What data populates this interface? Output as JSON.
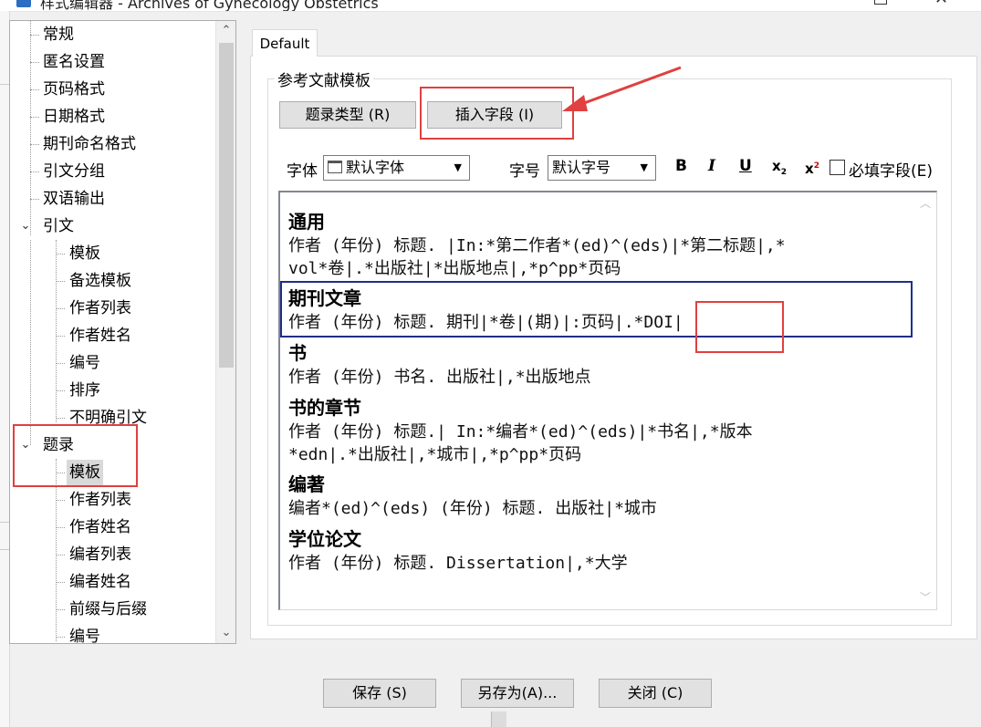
{
  "window": {
    "title": "样式编辑器 - Archives of Gynecology Obstetrics"
  },
  "tree": {
    "items": [
      {
        "label": "常规",
        "level": 1
      },
      {
        "label": "匿名设置",
        "level": 1
      },
      {
        "label": "页码格式",
        "level": 1
      },
      {
        "label": "日期格式",
        "level": 1
      },
      {
        "label": "期刊命名格式",
        "level": 1
      },
      {
        "label": "引文分组",
        "level": 1
      },
      {
        "label": "双语输出",
        "level": 1
      },
      {
        "label": "引文",
        "level": 1,
        "expanded": true
      },
      {
        "label": "模板",
        "level": 2
      },
      {
        "label": "备选模板",
        "level": 2
      },
      {
        "label": "作者列表",
        "level": 2
      },
      {
        "label": "作者姓名",
        "level": 2
      },
      {
        "label": "编号",
        "level": 2
      },
      {
        "label": "排序",
        "level": 2
      },
      {
        "label": "不明确引文",
        "level": 2
      },
      {
        "label": "题录",
        "level": 1,
        "expanded": true
      },
      {
        "label": "模板",
        "level": 2,
        "selected": true
      },
      {
        "label": "作者列表",
        "level": 2
      },
      {
        "label": "作者姓名",
        "level": 2
      },
      {
        "label": "编者列表",
        "level": 2
      },
      {
        "label": "编者姓名",
        "level": 2
      },
      {
        "label": "前缀与后缀",
        "level": 2
      },
      {
        "label": "编号",
        "level": 2
      }
    ]
  },
  "tab": {
    "label": "Default"
  },
  "group": {
    "title": "参考文献模板"
  },
  "toolbar": {
    "ref_type_label": "题录类型",
    "ref_type_key": "(R)",
    "insert_field_label": "插入字段",
    "insert_field_key": "(I)",
    "font_label": "字体",
    "font_value": "默认字体",
    "size_label": "字号",
    "size_value": "默认字号",
    "bold": "B",
    "italic": "I",
    "underline": "U",
    "subscript": "x",
    "subscript_mark": "2",
    "superscript": "x",
    "superscript_mark": "2",
    "required_label": "必填字段",
    "required_key": "(E)"
  },
  "templates": [
    {
      "name": "通用",
      "lines": [
        "作者 (年份) 标题. |In:*第二作者*(ed)^(eds)|*第二标题|,*",
        "vol*卷|.*出版社|*出版地点|,*p^pp*页码"
      ]
    },
    {
      "name": "期刊文章",
      "lines": [
        "作者 (年份) 标题. 期刊|*卷|(期)|:页码|.*DOI|"
      ]
    },
    {
      "name": "书",
      "lines": [
        "作者 (年份) 书名. 出版社|,*出版地点"
      ]
    },
    {
      "name": "书的章节",
      "lines": [
        "作者 (年份) 标题.| In:*编者*(ed)^(eds)|*书名|,*版本",
        "*edn|.*出版社|,*城市|,*p^pp*页码"
      ]
    },
    {
      "name": "编著",
      "lines": [
        "编者*(ed)^(eds) (年份) 标题. 出版社|*城市"
      ]
    },
    {
      "name": "学位论文",
      "lines": [
        "作者 (年份) 标题. Dissertation|,*大学"
      ]
    }
  ],
  "footer": {
    "save_label": "保存",
    "save_key": "(S)",
    "save_as_label": "另存为",
    "save_as_key": "(A)...",
    "close_label": "关闭",
    "close_key": "(C)"
  },
  "colors": {
    "annotation_red": "#e04040",
    "selection_navy": "#1f2f87"
  }
}
